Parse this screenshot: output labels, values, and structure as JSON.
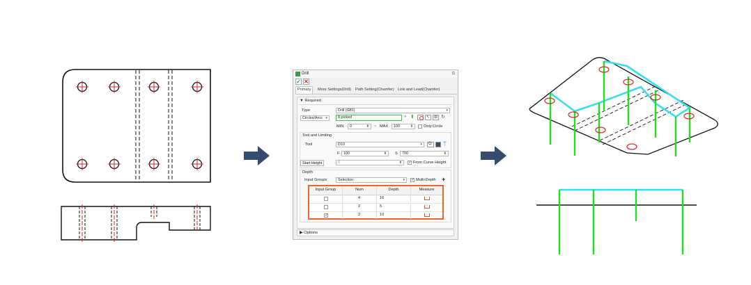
{
  "dialog": {
    "title": "Drill",
    "tabs": [
      {
        "label": "Primary",
        "active": true
      },
      {
        "label": "More Settings(Drill)",
        "active": false
      },
      {
        "label": "Path Setting(Chamfer)",
        "active": false
      },
      {
        "label": "Link and Lead(Chamfer)",
        "active": false
      }
    ],
    "required": {
      "header": "Required",
      "type_label": "Type",
      "type_value": "Drill (G81)",
      "selector_value": "Circles/Arcs",
      "picked_value": "8 picked",
      "min_label": "MIN",
      "min_value": "0",
      "max_label": "MAX",
      "max_value": "100",
      "only_circle_label": "Only Circle",
      "tilde": "~"
    },
    "tool": {
      "header": "Tool and Limiting",
      "tool_label": "Tool",
      "tool_value": "D10",
      "f_label": "F",
      "f_value": "100",
      "s_label": "S",
      "s_value": "700",
      "start_height_button": "Start Height",
      "start_height_value": "0",
      "from_curve_height_label": "From Curve Height"
    },
    "depth": {
      "header": "Depth",
      "input_groups_label": "Input Groups",
      "input_groups_value": "Selection",
      "multi_depth_label": "Multi-Depth",
      "table": {
        "columns": [
          "Input Group",
          "Num",
          "Depth",
          "Measure"
        ],
        "rows": [
          {
            "checked": false,
            "num": "4",
            "depth": "16"
          },
          {
            "checked": false,
            "num": "2",
            "depth": "5"
          },
          {
            "checked": true,
            "num": "2",
            "depth": "10"
          }
        ]
      }
    },
    "options": {
      "header": "Options"
    }
  },
  "colors": {
    "arrow": "#344d6e",
    "highlight": "#e8662a",
    "cyan": "#33e0f0",
    "green": "#22dd22",
    "hole": "#e02020"
  }
}
